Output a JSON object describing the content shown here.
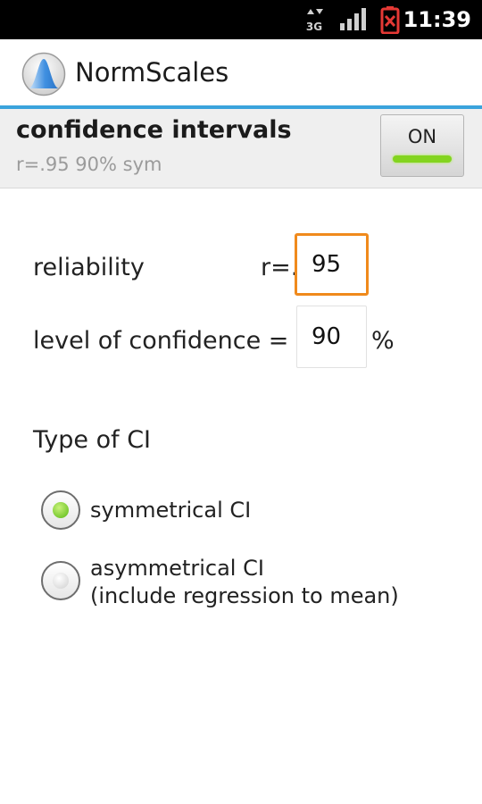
{
  "status_bar": {
    "network_label": "3G",
    "time": "11:39"
  },
  "app": {
    "title": "NormScales"
  },
  "confidence_intervals": {
    "title": "confidence intervals",
    "summary": "r=.95 90% sym",
    "toggle_label": "ON",
    "toggle_on": true
  },
  "form": {
    "reliability_label": "reliability",
    "reliability_prefix": "r=.",
    "reliability_value": "95",
    "confidence_label": "level of confidence =",
    "confidence_value": "90",
    "confidence_unit": "%"
  },
  "ci_type": {
    "heading": "Type of CI",
    "options": [
      {
        "label": "symmetrical CI",
        "selected": true
      },
      {
        "label": "asymmetrical CI",
        "sublabel": "(include regression to mean)",
        "selected": false
      }
    ]
  },
  "colors": {
    "accent_blue": "#3aa3dc",
    "focus_orange": "#f08a1c",
    "toggle_green": "#83d41f",
    "battery_red": "#e53935"
  }
}
